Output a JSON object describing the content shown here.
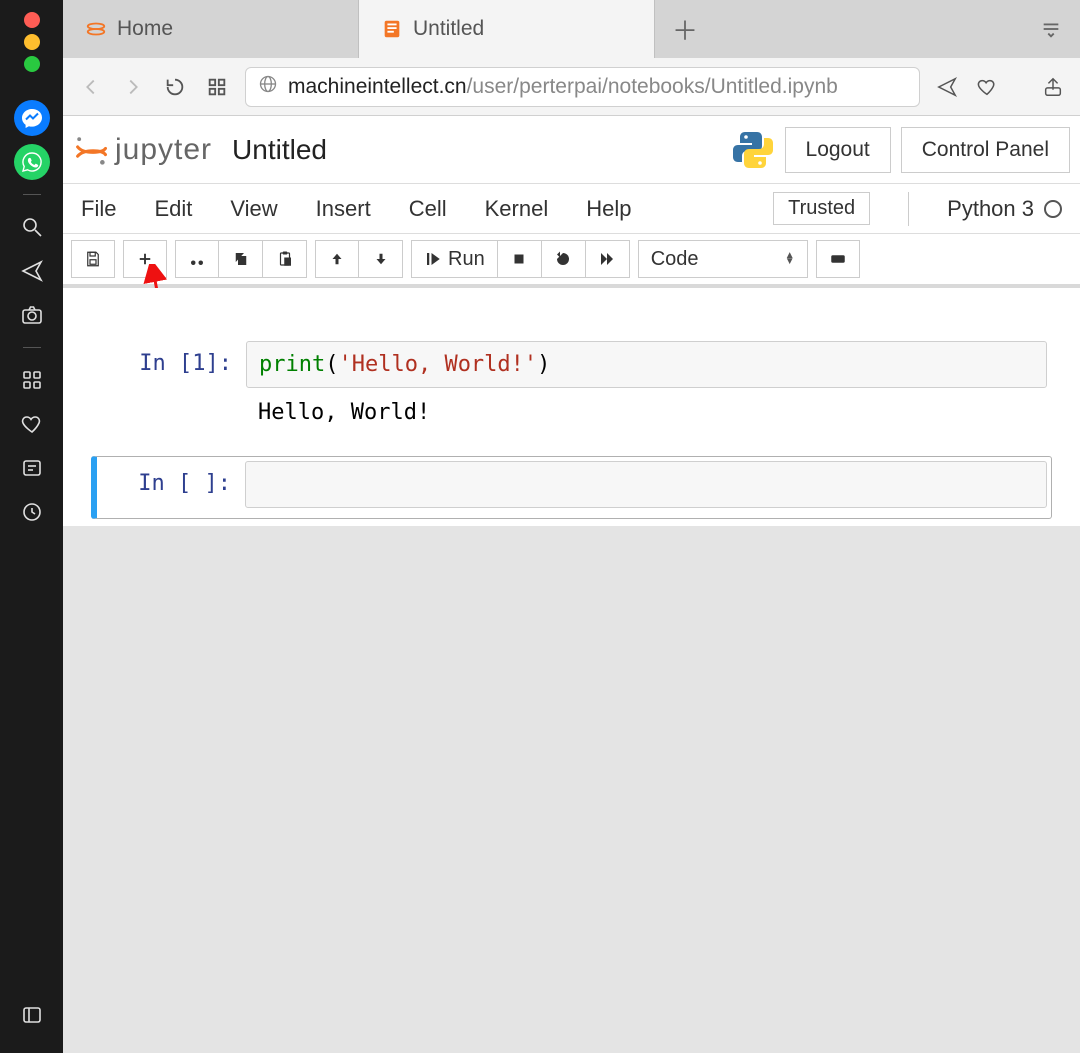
{
  "browser_tabs": {
    "tab_home_label": "Home",
    "tab_notebook_label": "Untitled"
  },
  "url": {
    "host": "machineintellect.cn",
    "path": "/user/perterpai/notebooks/Untitled.ipynb"
  },
  "jupyter": {
    "brand": "jupyter",
    "title": "Untitled",
    "logout_label": "Logout",
    "control_panel_label": "Control Panel"
  },
  "menubar": {
    "file": "File",
    "edit": "Edit",
    "view": "View",
    "insert": "Insert",
    "cell": "Cell",
    "kernel": "Kernel",
    "help": "Help",
    "trusted": "Trusted",
    "kernel_name": "Python 3"
  },
  "toolbar": {
    "run_label": "Run",
    "celltype_value": "Code"
  },
  "cells": {
    "c1_prompt": "In [1]:",
    "c1_code_kw": "print",
    "c1_code_open": "(",
    "c1_code_str": "'Hello, World!'",
    "c1_code_close": ")",
    "c1_output": "Hello, World!",
    "c2_prompt": "In [ ]:"
  }
}
